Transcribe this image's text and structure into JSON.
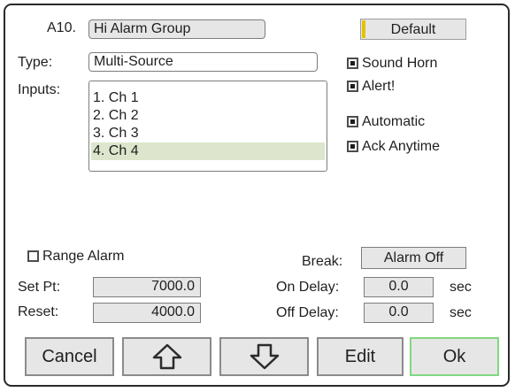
{
  "header": {
    "alarm_id": "A10.",
    "alarm_name": "Hi Alarm Group",
    "default_label": "Default"
  },
  "type": {
    "label": "Type:",
    "value": "Multi-Source"
  },
  "inputs": {
    "label": "Inputs:",
    "items": [
      "1. Ch 1",
      "2. Ch 2",
      "3. Ch 3",
      "4. Ch 4"
    ],
    "selected_index": 3
  },
  "options": {
    "sound_horn": {
      "label": "Sound Horn",
      "checked": true
    },
    "alert": {
      "label": "Alert!",
      "checked": true
    },
    "automatic": {
      "label": "Automatic",
      "checked": true
    },
    "ack_anytime": {
      "label": "Ack Anytime",
      "checked": true
    }
  },
  "range_alarm": {
    "label": "Range Alarm",
    "checked": false
  },
  "set_pt": {
    "label": "Set Pt:",
    "value": "7000.0"
  },
  "reset": {
    "label": "Reset:",
    "value": "4000.0"
  },
  "break": {
    "label": "Break:",
    "value": "Alarm Off"
  },
  "on_delay": {
    "label": "On Delay:",
    "value": "0.0",
    "unit": "sec"
  },
  "off_delay": {
    "label": "Off Delay:",
    "value": "0.0",
    "unit": "sec"
  },
  "buttons": {
    "cancel": "Cancel",
    "up": "up-arrow-icon",
    "down": "down-arrow-icon",
    "edit": "Edit",
    "ok": "Ok"
  },
  "colors": {
    "selected_row": "#dde6cc",
    "ok_border": "#80d880",
    "default_accent": "#e5c200",
    "button_fill": "#e6e6e6"
  }
}
